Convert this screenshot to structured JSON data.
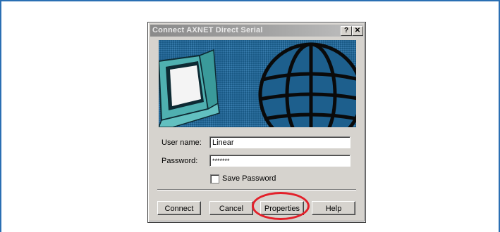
{
  "dialog": {
    "title": "Connect AXNET Direct Serial",
    "help_button": "?",
    "close_button": "✕"
  },
  "form": {
    "username_label": "User name:",
    "username_value": "Linear",
    "password_label": "Password:",
    "password_value": "*******",
    "save_password_label": "Save Password",
    "save_password_checked": false
  },
  "buttons": {
    "connect": "Connect",
    "cancel": "Cancel",
    "properties": "Properties",
    "help": "Help"
  },
  "annotation": {
    "highlight_color": "#e3202a"
  }
}
